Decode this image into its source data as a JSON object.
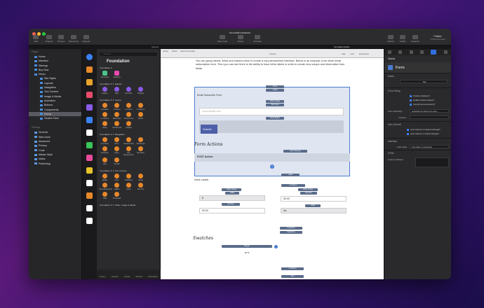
{
  "window": {
    "title": "foundationstacks",
    "tab": "foundationstacks",
    "sidebar_tab": "Sidebar"
  },
  "toolbar": {
    "left": [
      "Add",
      "Projects",
      "Themes",
      "Resources",
      "Snippets"
    ],
    "center": [
      "View Code",
      "Reset",
      "Simulate"
    ],
    "right": [
      "Addons",
      "Health",
      "Inspector"
    ],
    "publish": "Publish",
    "publish_sub": "Untitled destination"
  },
  "sidebar": {
    "pages_header": "Pages",
    "pages": [
      "Home",
      "Manifest",
      "Sitemap",
      "Buy Now",
      "Demo",
      "Site Styles",
      "Layouts",
      "Navigation",
      "Text Content",
      "Image & Media",
      "Animation",
      "Buttons",
      "Components",
      "Forms",
      "Swatch Pack"
    ],
    "settings_header": "Settings",
    "settings": [
      "General",
      "Web Icons",
      "Advanced",
      "Privacy",
      "Code",
      "Master Style",
      "Notes",
      "Publishing"
    ]
  },
  "library": {
    "search_placeholder": "Search",
    "title": "Foundation",
    "sections": [
      {
        "name": "Foundation 6",
        "items": [
          "Site Styles",
          "Swatches"
        ]
      },
      {
        "name": "Foundation 6 ✦ Helpers",
        "items": [
          "Classes",
          "Shell",
          "Div Class",
          "Snippets"
        ]
      },
      {
        "name": "Foundation 6 ✦ Layout",
        "items": [
          "Container",
          "1 Column",
          "2 Column",
          "3 Columns",
          "4 Columns",
          "Block Grid",
          "Columns Pro",
          "Divider",
          "Sticky",
          "Vertical Grid",
          "Visibility"
        ]
      },
      {
        "name": "Foundation 6 ✦ Navigation",
        "items": [
          "Accordion",
          "Menu",
          "Breadcrumbs",
          "Off-Canvas",
          "Dropdown",
          "Menu",
          "Nav Breadcrumbs",
          "Nav Menu",
          "Tabs",
          "Top Bar"
        ]
      },
      {
        "name": "Foundation 6 ✦ Text Content",
        "items": [
          "Badge",
          "Code",
          "Definitions",
          "Labels",
          "Accomplishments",
          "Callout",
          "Quote",
          "Nav Text",
          "Table",
          "Thumbnail"
        ]
      },
      {
        "name": "Foundation 6 ✦ Video, Image & Media",
        "items": []
      }
    ],
    "bottom": [
      "Library",
      "Updates",
      "Details",
      "Window",
      "Placeables"
    ]
  },
  "canvas": {
    "toolbar_left": [
      "Library",
      "Partial",
      "External Template"
    ],
    "toolbar_center": "Console",
    "toolbar_right": [
      "Hide",
      "Lock",
      "Preferences"
    ],
    "intro": "You can group labels, fields and buttons inline to create a very streamlined interface. Below is an example of an inline email subscription form. Then you can see there is the ability to have inline labels in order to create very unique and informative form fields.",
    "pills": {
      "form": "Form",
      "label": "Label",
      "inline_group": "Inline Group",
      "text_input": "Text Input",
      "inline_button": "Inline Button",
      "ajax_request": "Ajax Request",
      "label2": "Label",
      "two_column": "2 Column",
      "number": "Number",
      "container": "Container",
      "swatches": "Swatches",
      "margin": "Margin",
      "one_column": "1 Column",
      "text": "Text"
    },
    "form_heading": "Email Subscribe Form",
    "email_placeholder": "youexample.com",
    "submit": "Submit",
    "form_actions": "Form Actions",
    "post_action": "POST Action:",
    "inline_labels": "Inline Labels",
    "dollar": "$",
    "val1": "50.00",
    "val2": "50.00",
    "lbs": "lbs",
    "swatches_heading": "Swatches",
    "pre": "pre"
  },
  "inspector": {
    "title": "Stacks",
    "element": "Form",
    "notes": "Notes",
    "title_field": "Title",
    "setup": "Form Setup",
    "checks": [
      "Position Relative?",
      "Enable Autocomplete?",
      "Asynchronous Actions?"
    ],
    "encoding_label": "Form Encoding",
    "encoding_value": "application/x-www-form-urlen...",
    "timeout_label": "Timeout",
    "auto_submit": "Auto Submit",
    "auto_checks": [
      "Auto Submit on Select Change?",
      "Auto Submit on Field Change?"
    ],
    "interface": "Interface",
    "auto_caps_label": "Auto Caps",
    "auto_caps_value": "First letter of sentences",
    "html": "HTML",
    "custom_classes": "Custom Classes"
  }
}
